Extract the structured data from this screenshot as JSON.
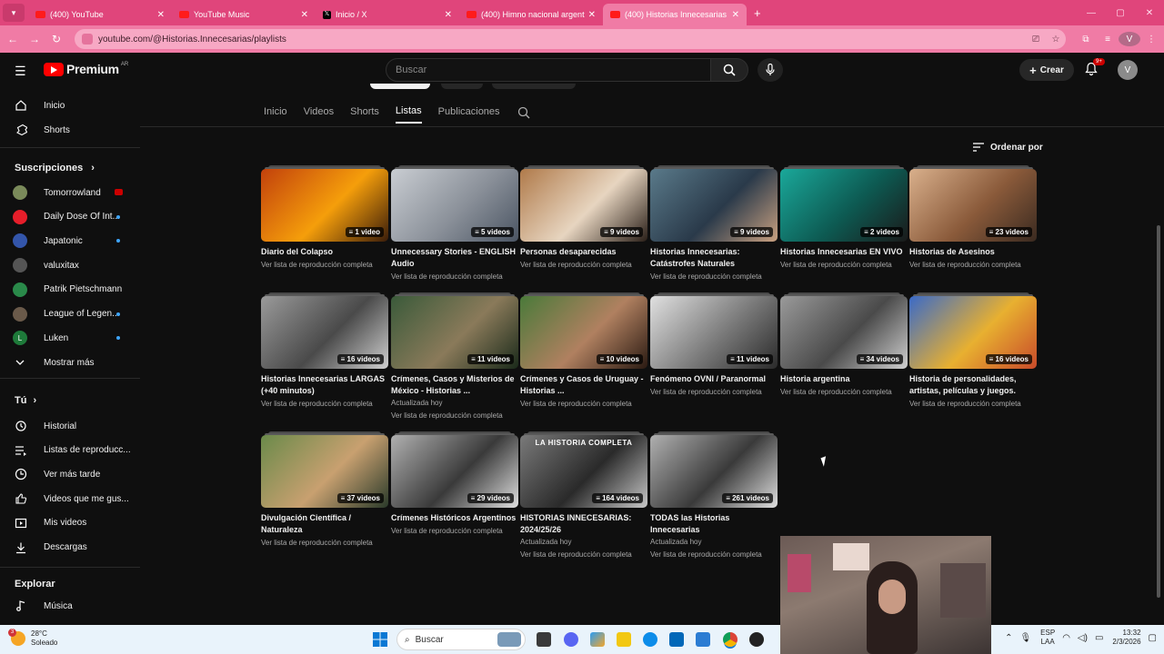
{
  "browser": {
    "tabs": [
      {
        "title": "(400) YouTube",
        "favicon": "youtube-icon",
        "active": false
      },
      {
        "title": "YouTube Music",
        "favicon": "youtube-music-icon",
        "active": false
      },
      {
        "title": "Inicio / X",
        "favicon": "x-icon",
        "active": false
      },
      {
        "title": "(400) Himno nacional argentino",
        "favicon": "youtube-icon",
        "active": false
      },
      {
        "title": "(400) Historias Innecesarias - Yo",
        "favicon": "youtube-icon",
        "active": true
      }
    ],
    "url": "youtube.com/@Historias.Innecesarias/playlists",
    "profile_initial": "V",
    "accent": "#e0457b"
  },
  "masthead": {
    "brand": "Premium",
    "country": "AR",
    "search_placeholder": "Buscar",
    "create_label": "Crear",
    "notif_count": "9+",
    "avatar_initial": "V"
  },
  "sidebar": {
    "main": [
      {
        "label": "Inicio",
        "icon": "home-icon"
      },
      {
        "label": "Shorts",
        "icon": "shorts-icon"
      }
    ],
    "subs_title": "Suscripciones",
    "subs": [
      {
        "label": "Tomorrowland",
        "color": "#7a8a5a",
        "indicator": "live"
      },
      {
        "label": "Daily Dose Of Int...",
        "color": "#e61e2a",
        "indicator": "dot"
      },
      {
        "label": "Japatonic",
        "color": "#3355aa",
        "indicator": "dot"
      },
      {
        "label": "valuxitax",
        "color": "#555555",
        "indicator": "none"
      },
      {
        "label": "Patrik Pietschmann",
        "color": "#2a8a4a",
        "indicator": "none"
      },
      {
        "label": "League of Legen...",
        "color": "#6a5a4a",
        "indicator": "dot"
      },
      {
        "label": "Luken",
        "color": "#1e7a3a",
        "indicator": "dot",
        "initial": "L"
      }
    ],
    "more_label": "Mostrar más",
    "you_title": "Tú",
    "you": [
      {
        "label": "Historial",
        "icon": "history-icon"
      },
      {
        "label": "Listas de reproducc...",
        "icon": "playlists-icon"
      },
      {
        "label": "Ver más tarde",
        "icon": "clock-icon"
      },
      {
        "label": "Videos que me gus...",
        "icon": "thumbs-up-icon"
      },
      {
        "label": "Mis videos",
        "icon": "my-videos-icon"
      },
      {
        "label": "Descargas",
        "icon": "download-icon"
      }
    ],
    "explore_title": "Explorar",
    "explore": [
      {
        "label": "Música",
        "icon": "music-icon"
      }
    ]
  },
  "channel_tabs": [
    "Inicio",
    "Videos",
    "Shorts",
    "Listas",
    "Publicaciones"
  ],
  "active_tab": "Listas",
  "sort_label": "Ordenar por",
  "view_full": "Ver lista de reproducción completa",
  "playlists": [
    {
      "title": "Diario del Colapso",
      "count": "1 video",
      "meta": "",
      "colors": [
        "#c2410c",
        "#f59e0b",
        "#3b1d0a"
      ]
    },
    {
      "title": "Unnecessary Stories - ENGLISH Audio",
      "count": "5 videos",
      "meta": "",
      "colors": [
        "#c9cdd2",
        "#8a9099",
        "#4b5563"
      ]
    },
    {
      "title": "Personas desaparecidas",
      "count": "9 videos",
      "meta": "",
      "colors": [
        "#b07a4a",
        "#e7d5c0",
        "#2a1f18"
      ]
    },
    {
      "title": "Historias Innecesarias: Catástrofes Naturales",
      "count": "9 videos",
      "meta": "",
      "colors": [
        "#5a7a8a",
        "#2a3a4a",
        "#c9a080"
      ]
    },
    {
      "title": "Historias Innecesarias EN VIVO",
      "count": "2 videos",
      "meta": "",
      "colors": [
        "#1aa89a",
        "#0d5a52",
        "#1a1a1a"
      ]
    },
    {
      "title": "Historias de Asesinos",
      "count": "23 videos",
      "meta": "",
      "colors": [
        "#d9b08c",
        "#8a5a3a",
        "#3a2a20"
      ]
    },
    {
      "title": "Historias Innecesarias LARGAS (+40 minutos)",
      "count": "16 videos",
      "meta": "",
      "colors": [
        "#9a9a9a",
        "#4a4a4a",
        "#d0d0d0"
      ]
    },
    {
      "title": "Crímenes, Casos y Misterios de México - Historias ...",
      "count": "11 videos",
      "meta": "Actualizada hoy",
      "colors": [
        "#3a5a3a",
        "#8a7a5a",
        "#1a2a1a"
      ]
    },
    {
      "title": "Crímenes y Casos de Uruguay - Historias ...",
      "count": "10 videos",
      "meta": "",
      "colors": [
        "#4a7a3a",
        "#b08060",
        "#2a1a12"
      ]
    },
    {
      "title": "Fenómeno OVNI / Paranormal",
      "count": "11 videos",
      "meta": "",
      "colors": [
        "#e0e0e0",
        "#7a7a7a",
        "#2a2a2a"
      ]
    },
    {
      "title": "Historia argentina",
      "count": "34 videos",
      "meta": "",
      "colors": [
        "#9a9a9a",
        "#4a4a4a",
        "#d0d0d0"
      ]
    },
    {
      "title": "Historia de personalidades, artistas, películas y juegos.",
      "count": "16 videos",
      "meta": "",
      "colors": [
        "#3a6ac8",
        "#e8b030",
        "#c84a2a"
      ]
    },
    {
      "title": "Divulgación Científica / Naturaleza",
      "count": "37 videos",
      "meta": "",
      "colors": [
        "#6a8a4a",
        "#c8a070",
        "#2a3a2a"
      ]
    },
    {
      "title": "Crímenes Históricos Argentinos",
      "count": "29 videos",
      "meta": "",
      "colors": [
        "#b0b0b0",
        "#3a3a3a",
        "#e0e0e0"
      ]
    },
    {
      "title": "HISTORIAS INNECESARIAS: 2024/25/26",
      "count": "164 videos",
      "meta": "Actualizada hoy",
      "banner": "LA HISTORIA COMPLETA",
      "colors": [
        "#7a7a7a",
        "#2a2a2a",
        "#c8c8c8"
      ]
    },
    {
      "title": "TODAS las Historias Innecesarias",
      "count": "261 videos",
      "meta": "Actualizada hoy",
      "colors": [
        "#b0b0b0",
        "#3a3a3a",
        "#e0e0e0"
      ]
    }
  ],
  "taskbar": {
    "weather_temp": "28°C",
    "weather_desc": "Soleado",
    "weather_badge": "3",
    "search_label": "Buscar",
    "lang": "ESP",
    "lang2": "LAA",
    "time": "13:32",
    "date": "2/3/2026"
  }
}
